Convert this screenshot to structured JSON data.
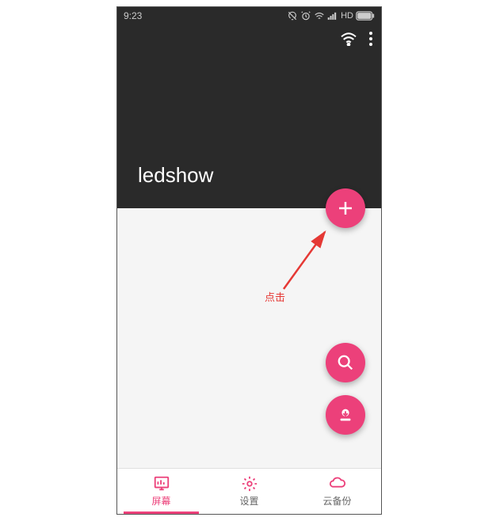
{
  "status": {
    "time": "9:23",
    "network_label": "HD"
  },
  "header": {
    "title": "ledshow"
  },
  "annotation": {
    "label": "点击"
  },
  "fab": {
    "add": "add",
    "search": "search",
    "download": "download"
  },
  "nav": {
    "items": [
      {
        "label": "屏幕",
        "icon": "chart",
        "active": true
      },
      {
        "label": "设置",
        "icon": "gear",
        "active": false
      },
      {
        "label": "云备份",
        "icon": "cloud",
        "active": false
      }
    ]
  },
  "colors": {
    "accent": "#ec407a",
    "dark": "#2a2a2a"
  }
}
